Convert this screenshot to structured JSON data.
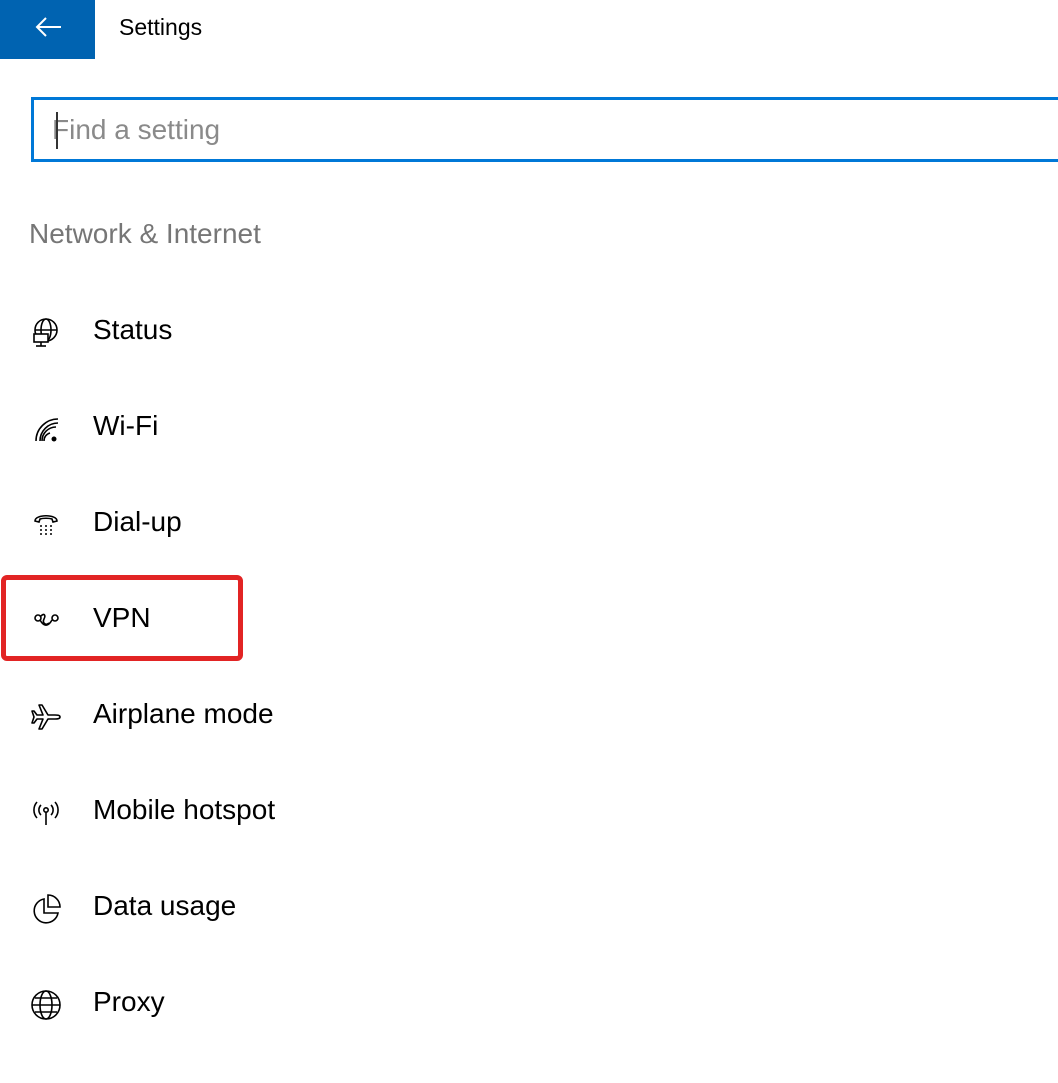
{
  "header": {
    "back_icon": "arrow-left-icon",
    "title": "Settings",
    "accent_color": "#0063b1"
  },
  "search": {
    "placeholder": "Find a setting",
    "value": ""
  },
  "section": {
    "title": "Network & Internet"
  },
  "nav": {
    "items": [
      {
        "label": "Status",
        "icon": "network-status-icon"
      },
      {
        "label": "Wi-Fi",
        "icon": "wifi-icon"
      },
      {
        "label": "Dial-up",
        "icon": "dialup-phone-icon"
      },
      {
        "label": "VPN",
        "icon": "vpn-icon",
        "highlighted": true
      },
      {
        "label": "Airplane mode",
        "icon": "airplane-icon"
      },
      {
        "label": "Mobile hotspot",
        "icon": "hotspot-icon"
      },
      {
        "label": "Data usage",
        "icon": "pie-chart-icon"
      },
      {
        "label": "Proxy",
        "icon": "globe-icon"
      }
    ]
  },
  "highlight_color": "#e22424"
}
